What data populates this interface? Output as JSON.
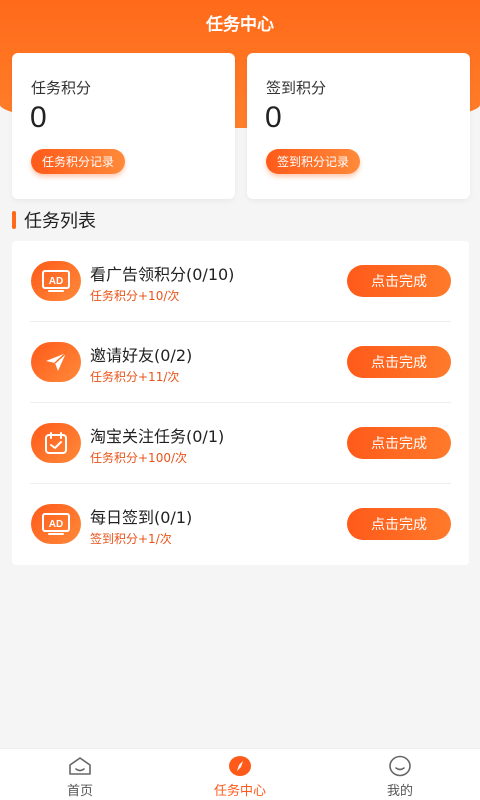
{
  "header": {
    "title": "任务中心"
  },
  "scores": [
    {
      "label": "任务积分",
      "value": "0",
      "record_label": "任务积分记录"
    },
    {
      "label": "签到积分",
      "value": "0",
      "record_label": "签到积分记录"
    }
  ],
  "section": {
    "title": "任务列表"
  },
  "tasks": [
    {
      "icon": "ad-icon",
      "name": "看广告领积分(0/10)",
      "reward": "任务积分+10/次",
      "button": "点击完成"
    },
    {
      "icon": "paper-plane-icon",
      "name": "邀请好友(0/2)",
      "reward": "任务积分+11/次",
      "button": "点击完成"
    },
    {
      "icon": "calendar-check-icon",
      "name": "淘宝关注任务(0/1)",
      "reward": "任务积分+100/次",
      "button": "点击完成"
    },
    {
      "icon": "ad-icon",
      "name": "每日签到(0/1)",
      "reward": "签到积分+1/次",
      "button": "点击完成"
    }
  ],
  "tabbar": [
    {
      "icon": "home-icon",
      "label": "首页"
    },
    {
      "icon": "compass-icon",
      "label": "任务中心",
      "active": true
    },
    {
      "icon": "profile-icon",
      "label": "我的"
    }
  ],
  "colors": {
    "accent": "#ff6a1a",
    "reward_text": "#e8541a"
  }
}
